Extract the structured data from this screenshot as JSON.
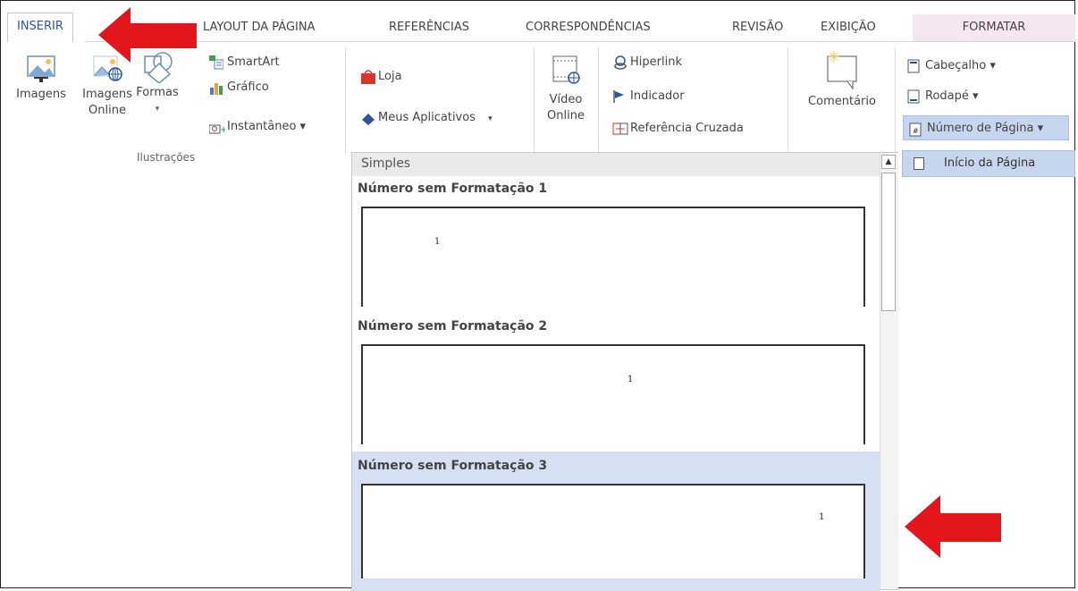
{
  "tabs": [
    {
      "label": "INSERIR"
    },
    {
      "label": "LAYOUT DA PÁGINA"
    },
    {
      "label": "REFERÊNCIAS"
    },
    {
      "label": "CORRESPONDÊNCIAS"
    },
    {
      "label": "REVISÃO"
    },
    {
      "label": "EXIBIÇÃO"
    },
    {
      "label": "FORMATAR"
    }
  ],
  "ribbon": {
    "imagens": "Imagens",
    "imagens_online_1": "Imagens",
    "imagens_online_2": "Online",
    "formas": "Formas",
    "formas_arrow": "▾",
    "smartart": "SmartArt",
    "grafico": "Gráfico",
    "instantaneo": "Instantâneo ▾",
    "group_ilustracoes": "Ilustrações",
    "loja": "Loja",
    "meus_aplicativos": "Meus Aplicativos",
    "meus_aplicativos_arrow": "▾",
    "video_1": "Vídeo",
    "video_2": "Online",
    "hiperlink": "Hiperlink",
    "indicador": "Indicador",
    "referencia_cruzada": "Referência Cruzada",
    "comentario": "Comentário",
    "cabecalho": "Cabeçalho ▾",
    "rodape": "Rodapé ▾",
    "numero_pagina": "Número de Página ▾"
  },
  "dropdown": {
    "header": "Simples",
    "items": [
      {
        "title": "Número sem Formatação 1",
        "number": "1"
      },
      {
        "title": "Número sem Formatação 2",
        "number": "1"
      },
      {
        "title": "Número sem Formatação 3",
        "number": "1"
      }
    ]
  },
  "submenu": {
    "label": "Início da Página"
  },
  "colors": {
    "accent": "#2b579a",
    "selected": "#d5e1f2",
    "arrow": "#e3161b",
    "format_tab": "#f6e6f0"
  }
}
